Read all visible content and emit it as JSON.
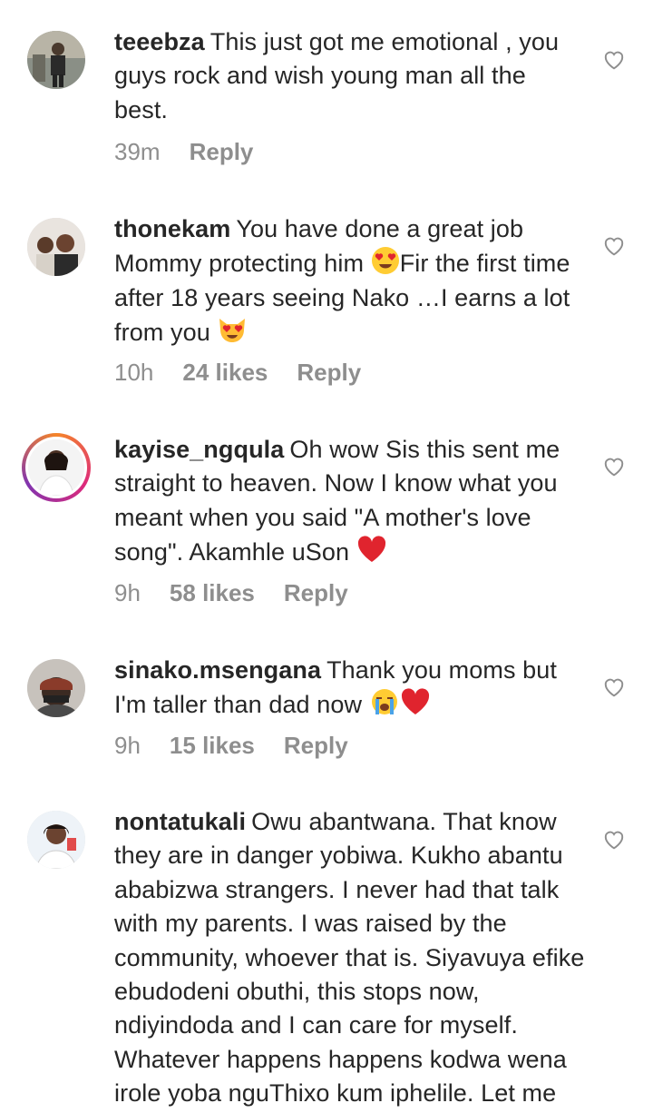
{
  "comments": [
    {
      "username": "teeebza",
      "text": "This just got me emotional , you guys rock and wish young man all the best.",
      "time": "39m",
      "likes": "",
      "reply": "Reply"
    },
    {
      "username": "thonekam",
      "text_a": "You have done a great job Mommy protecting him",
      "text_b": "Fir the first time after 18 years seeing Nako …I earns a lot from you",
      "time": "10h",
      "likes": "24 likes",
      "reply": "Reply"
    },
    {
      "username": "kayise_ngqula",
      "text": "Oh wow Sis this sent me straight to heaven. Now I know what you meant when you said \"A mother's love song\". Akamhle uSon",
      "time": "9h",
      "likes": "58 likes",
      "reply": "Reply"
    },
    {
      "username": "sinako.msengana",
      "text": "Thank you moms but I'm taller than dad now",
      "time": "9h",
      "likes": "15 likes",
      "reply": "Reply"
    },
    {
      "username": "nontatukali",
      "text": "Owu abantwana. That know they are in danger yobiwa. Kukho abantu ababizwa strangers. I never had that talk with my parents. I was raised by the community, whoever that is. Siyavuya efike ebudodeni obuthi, this stops now, ndiyindoda and I can care for myself. Whatever happens happens kodwa wena irole yoba nguThixo kum iphelile. Let me"
    }
  ],
  "icons": {
    "heart": "heart-outline-icon",
    "emoji_heart_eyes": "heart-eyes-emoji",
    "emoji_heart_eyes_cat": "heart-eyes-cat-emoji",
    "emoji_red_heart": "red-heart-emoji",
    "emoji_crying": "loudly-crying-emoji"
  },
  "colors": {
    "text": "#262626",
    "meta": "#8e8e8e",
    "heart_red": "#e0242e"
  }
}
